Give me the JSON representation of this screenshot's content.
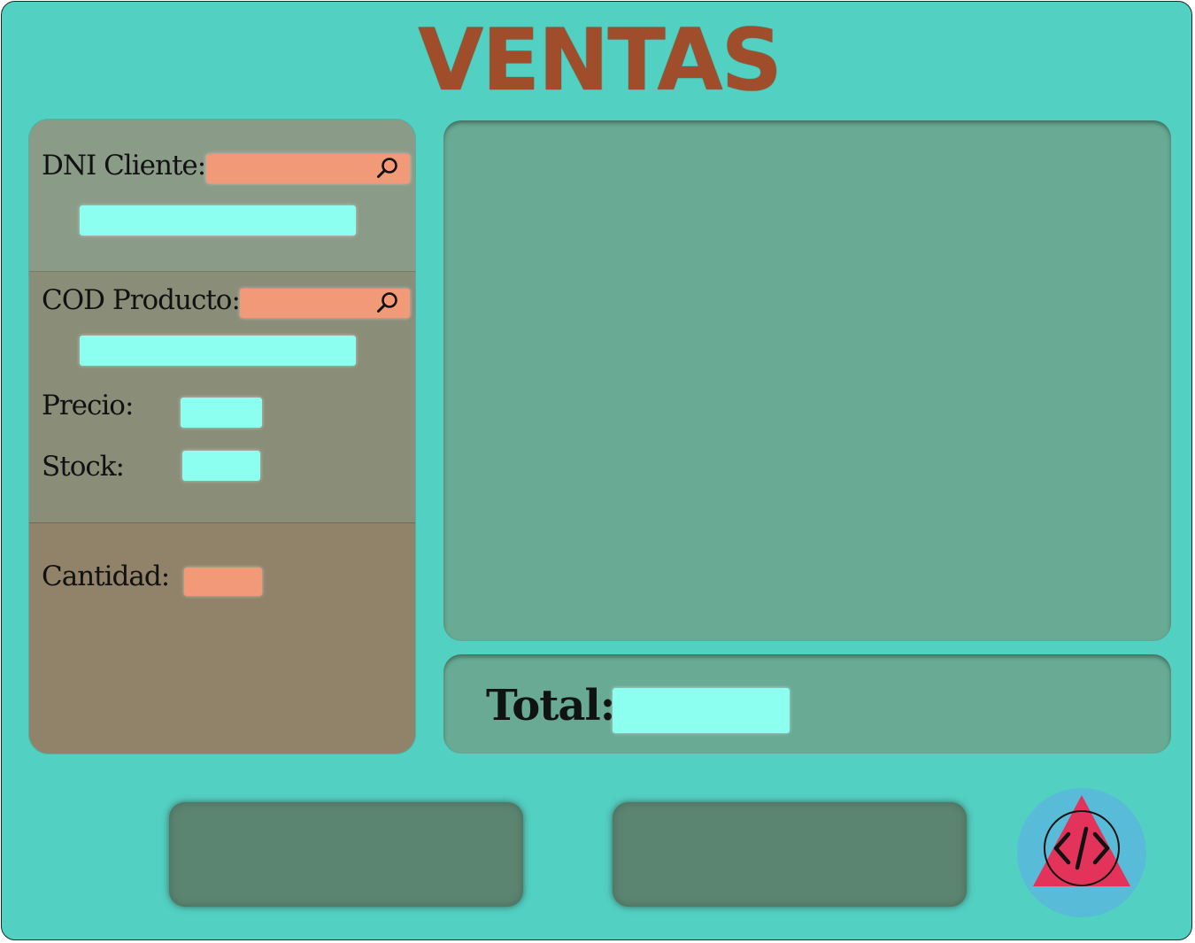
{
  "app": {
    "title": "VENTAS"
  },
  "cliente": {
    "dni_label": "DNI Cliente:",
    "dni_value": "",
    "nombre_value": ""
  },
  "producto": {
    "cod_label": "COD Producto:",
    "cod_value": "",
    "nombre_value": "",
    "precio_label": "Precio:",
    "precio_value": "",
    "stock_label": "Stock:",
    "stock_value": ""
  },
  "venta": {
    "cantidad_label": "Cantidad:",
    "cantidad_value": ""
  },
  "total": {
    "label": "Total:",
    "value": ""
  },
  "icons": {
    "search": "search-icon",
    "logo": "code-icon"
  },
  "colors": {
    "background": "#52d0c2",
    "title": "#a04d2b",
    "input_editable": "#f29a78",
    "input_readonly": "#8cfff0",
    "panel": "#68aa93",
    "button": "#5c8571"
  }
}
